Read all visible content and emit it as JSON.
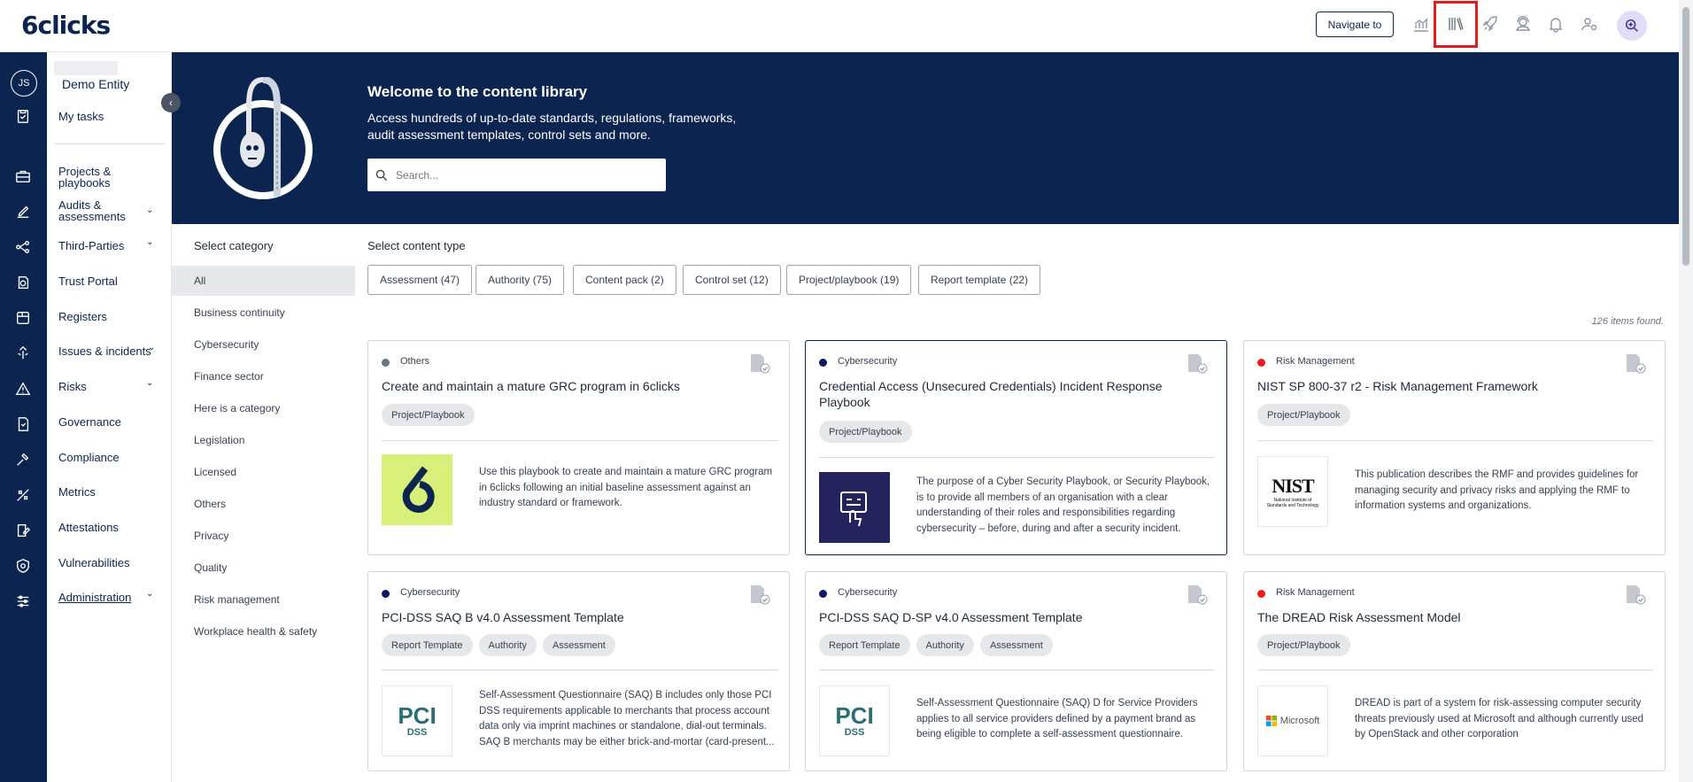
{
  "brand": {
    "logo_text": "6clicks"
  },
  "topbar": {
    "navigate_label": "Navigate to",
    "icons": [
      "analytics-icon",
      "library-icon",
      "rocket-icon",
      "support-icon",
      "bell-icon",
      "user-settings-icon",
      "global-search-icon"
    ]
  },
  "user": {
    "initials": "JS"
  },
  "sidebar": {
    "entity": "Demo Entity",
    "my_tasks": "My tasks",
    "items": [
      {
        "label": "Projects & playbooks",
        "expandable": false
      },
      {
        "label": "Audits & assessments",
        "expandable": true
      },
      {
        "label": "Third-Parties",
        "expandable": true
      },
      {
        "label": "Trust Portal",
        "expandable": false
      },
      {
        "label": "Registers",
        "expandable": false
      },
      {
        "label": "Issues & incidents",
        "expandable": true
      },
      {
        "label": "Risks",
        "expandable": true
      },
      {
        "label": "Governance",
        "expandable": false
      },
      {
        "label": "Compliance",
        "expandable": false
      },
      {
        "label": "Metrics",
        "expandable": false
      },
      {
        "label": "Attestations",
        "expandable": false
      },
      {
        "label": "Vulnerabilities",
        "expandable": false
      },
      {
        "label": "Administration",
        "expandable": true
      }
    ]
  },
  "hero": {
    "title": "Welcome to the content library",
    "subtitle": "Access hundreds of up-to-date standards, regulations, frameworks, audit assessment templates, control sets and more.",
    "search_placeholder": "Search..."
  },
  "categories": {
    "title": "Select category",
    "items": [
      "All",
      "Business continuity",
      "Cybersecurity",
      "Finance sector",
      "Here is a category",
      "Legislation",
      "Licensed",
      "Others",
      "Privacy",
      "Quality",
      "Risk management",
      "Workplace health & safety"
    ],
    "selected": "All"
  },
  "content_types": {
    "title": "Select content type",
    "items": [
      "Assessment (47)",
      "Authority (75)",
      "Content pack (2)",
      "Control set (12)",
      "Project/playbook (19)",
      "Report template (22)"
    ]
  },
  "results": {
    "count_text": "126 items found."
  },
  "colors": {
    "navy": "#0b2550",
    "cat_others": "#6b7280",
    "cat_cyber": "#0b1a66",
    "cat_risk": "#ef1b1b"
  },
  "cards": [
    {
      "category": "Others",
      "dot": "#6b7280",
      "title": "Create and maintain a mature GRC program in 6clicks",
      "tags": [
        "Project/Playbook"
      ],
      "thumb": "6clicks-logo",
      "description": "Use this playbook to create and maintain a mature GRC program in 6clicks following an initial baseline assessment against an industry standard or framework."
    },
    {
      "category": "Cybersecurity",
      "dot": "#0b1a66",
      "title": "Credential Access (Unsecured Credentials) Incident Response Playbook",
      "tags": [
        "Project/Playbook"
      ],
      "thumb": "playbook-logo",
      "description": "The purpose of a Cyber Security Playbook, or Security Playbook, is to provide all members of an organisation with a clear understanding of their roles and responsibilities regarding cybersecurity – before, during and after a security incident."
    },
    {
      "category": "Risk Management",
      "dot": "#ef1b1b",
      "title": "NIST SP 800-37 r2 - Risk Management Framework",
      "tags": [
        "Project/Playbook"
      ],
      "thumb": "nist-logo",
      "thumb_text": "NIST",
      "thumb_sub": "National Institute of Standards and Technology",
      "description": "This publication describes the RMF and provides guidelines for managing security and privacy risks and applying the RMF to information systems and organizations."
    },
    {
      "category": "Cybersecurity",
      "dot": "#0b1a66",
      "title": "PCI-DSS SAQ B v4.0 Assessment Template",
      "tags": [
        "Report Template",
        "Authority",
        "Assessment"
      ],
      "thumb": "pci-logo",
      "thumb_text": "PCI",
      "thumb_sub": "DSS",
      "description": "Self-Assessment Questionnaire (SAQ) B includes only those PCI DSS requirements applicable to merchants that process account data only via imprint machines or standalone, dial-out terminals. SAQ B merchants may be either brick-and-mortar (card-present..."
    },
    {
      "category": "Cybersecurity",
      "dot": "#0b1a66",
      "title": "PCI-DSS SAQ D-SP v4.0 Assessment Template",
      "tags": [
        "Report Template",
        "Authority",
        "Assessment"
      ],
      "thumb": "pci-logo",
      "thumb_text": "PCI",
      "thumb_sub": "DSS",
      "description": "Self-Assessment Questionnaire (SAQ) D for Service Providers applies to all service providers defined by a payment brand as being eligible to complete a self-assessment questionnaire."
    },
    {
      "category": "Risk Management",
      "dot": "#ef1b1b",
      "title": "The DREAD Risk Assessment Model",
      "tags": [
        "Project/Playbook"
      ],
      "thumb": "microsoft-logo",
      "thumb_text": "Microsoft",
      "description": "DREAD is part of a system for risk-assessing computer security threats previously used at Microsoft and although currently used by OpenStack and other corporation"
    }
  ]
}
